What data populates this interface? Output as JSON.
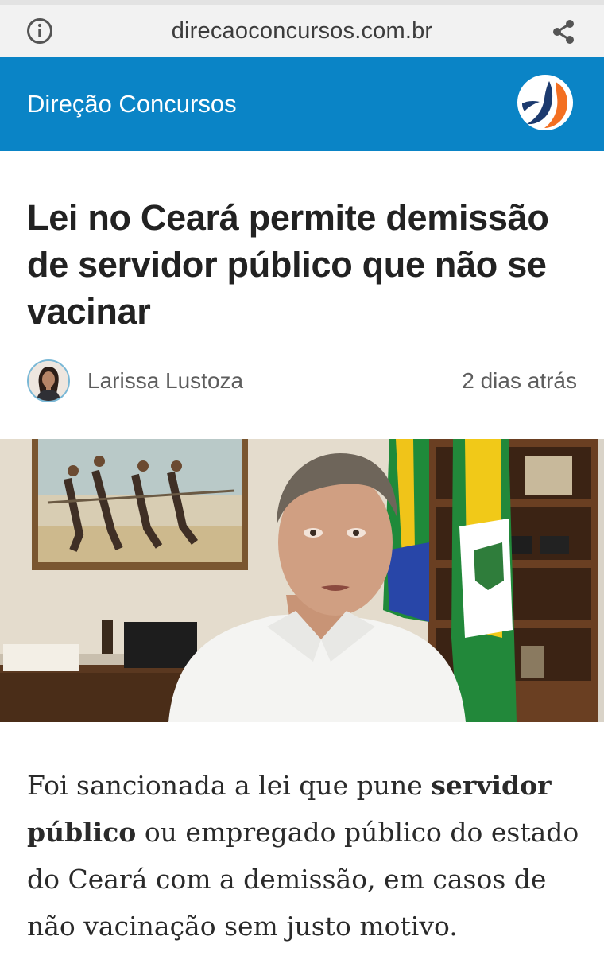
{
  "browser": {
    "url": "direcaoconcursos.com.br"
  },
  "header": {
    "site_name": "Direção Concursos"
  },
  "article": {
    "title": "Lei no Ceará permite demissão de servidor público que não se vacinar",
    "author": "Larissa Lustoza",
    "published": "2 dias atrás",
    "lead": {
      "part1": "Foi sancionada a lei que pune ",
      "bold": "servidor público",
      "part2": " ou empregado público do estado do Ceará com a demissão, em casos de não vacinação sem justo motivo."
    }
  },
  "icons": {
    "info": "info-icon",
    "share": "share-icon",
    "logo": "site-logo",
    "avatar": "author-avatar"
  },
  "colors": {
    "brand_blue": "#0a84c6",
    "logo_orange": "#f36f21",
    "logo_navy": "#1c3a6e",
    "headline": "#222222",
    "meta_text": "#5d5d5d"
  }
}
